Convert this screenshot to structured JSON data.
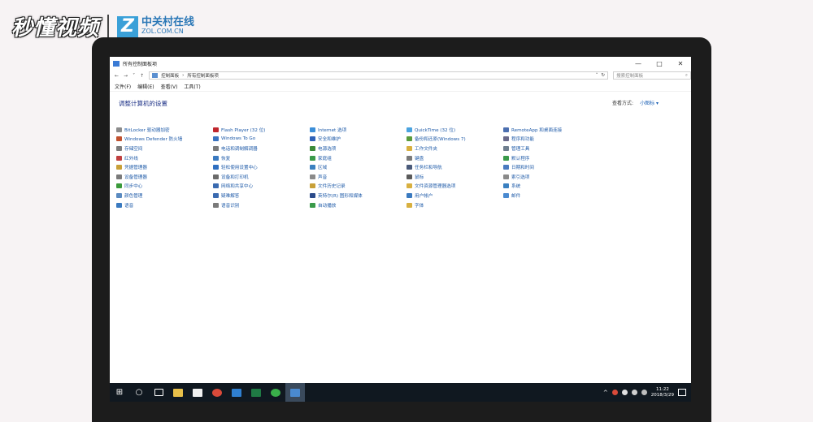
{
  "watermark": {
    "brand": "秒懂视频",
    "logo_letter": "Z",
    "cn": "中关村在线",
    "en": "ZOL.COM.CN"
  },
  "window": {
    "title": "所有控制面板项",
    "controls": [
      "—",
      "□",
      "✕"
    ]
  },
  "nav": {
    "back": "←",
    "forward": "→",
    "down": "˅",
    "up": "↑",
    "address_parts": [
      "控制面板",
      "›",
      "所有控制面板项"
    ],
    "address_dropdown": "˅",
    "refresh": "↻",
    "search_placeholder": "搜索控制面板",
    "search_icon": "⌕"
  },
  "menu": [
    "文件(F)",
    "编辑(E)",
    "查看(V)",
    "工具(T)"
  ],
  "heading": "调整计算机的设置",
  "view_by": {
    "label": "查看方式:",
    "value": "小图标 ▾"
  },
  "items": [
    {
      "label": "BitLocker 驱动器加密",
      "color": "#8c8c8c"
    },
    {
      "label": "Flash Player (32 位)",
      "color": "#c0262d"
    },
    {
      "label": "Internet 选项",
      "color": "#3b8ed8"
    },
    {
      "label": "QuickTime (32 位)",
      "color": "#4aa3df"
    },
    {
      "label": "RemoteApp 和桌面连接",
      "color": "#4c6fb0"
    },
    {
      "label": "Windows Defender 防火墙",
      "color": "#c0512f"
    },
    {
      "label": "Windows To Go",
      "color": "#3a73c0"
    },
    {
      "label": "安全和维护",
      "color": "#2f62b8"
    },
    {
      "label": "备份和还原(Windows 7)",
      "color": "#5a9b3c"
    },
    {
      "label": "程序和功能",
      "color": "#6a6a8a"
    },
    {
      "label": "存储空间",
      "color": "#7c7c7c"
    },
    {
      "label": "电话和调制解调器",
      "color": "#7a7a7a"
    },
    {
      "label": "电源选项",
      "color": "#3a8a3a"
    },
    {
      "label": "工作文件夹",
      "color": "#d8b040"
    },
    {
      "label": "管理工具",
      "color": "#6f7f8f"
    },
    {
      "label": "红外线",
      "color": "#c04040"
    },
    {
      "label": "恢复",
      "color": "#3a7ac0"
    },
    {
      "label": "家庭组",
      "color": "#3a9a4a"
    },
    {
      "label": "键盘",
      "color": "#7a7a7a"
    },
    {
      "label": "默认程序",
      "color": "#3a9a4a"
    },
    {
      "label": "凭据管理器",
      "color": "#c8a038"
    },
    {
      "label": "轻松使用设置中心",
      "color": "#2f6fc0"
    },
    {
      "label": "区域",
      "color": "#3a80c0"
    },
    {
      "label": "任务栏和导航",
      "color": "#4a5a7a"
    },
    {
      "label": "日期和时间",
      "color": "#4a7ac0"
    },
    {
      "label": "设备管理器",
      "color": "#7a7a7a"
    },
    {
      "label": "设备和打印机",
      "color": "#6a6a6a"
    },
    {
      "label": "声音",
      "color": "#8a8a8a"
    },
    {
      "label": "鼠标",
      "color": "#5a5a5a"
    },
    {
      "label": "索引选项",
      "color": "#8a8a8a"
    },
    {
      "label": "同步中心",
      "color": "#3a9a3a"
    },
    {
      "label": "网络和共享中心",
      "color": "#3a6ab0"
    },
    {
      "label": "文件历史记录",
      "color": "#c8a038"
    },
    {
      "label": "文件资源管理器选项",
      "color": "#d8b040"
    },
    {
      "label": "系统",
      "color": "#3a80c0"
    },
    {
      "label": "颜色管理",
      "color": "#5a8ac0"
    },
    {
      "label": "疑难解答",
      "color": "#3a6ab0"
    },
    {
      "label": "英特尔(R) 图形和媒体",
      "color": "#2a4a8a"
    },
    {
      "label": "用户帐户",
      "color": "#3a7ac0"
    },
    {
      "label": "邮件",
      "color": "#4a8ad0"
    },
    {
      "label": "语音",
      "color": "#3a7ac0"
    },
    {
      "label": "语音识别",
      "color": "#7a7a7a"
    },
    {
      "label": "自动播放",
      "color": "#3a9a4a"
    },
    {
      "label": "字体",
      "color": "#d8b040"
    }
  ],
  "taskbar": {
    "start_icon": "⊞",
    "search_icon": "○",
    "apps": [
      {
        "name": "task-view-icon",
        "color": "#101820"
      },
      {
        "name": "file-explorer-icon",
        "color": "#e8c04a"
      },
      {
        "name": "sticky-notes-icon",
        "color": "#f0f0f0"
      },
      {
        "name": "chrome-icon",
        "color": "#d94a3a"
      },
      {
        "name": "edge-icon",
        "color": "#2f7fd0"
      },
      {
        "name": "excel-icon",
        "color": "#1f7a44"
      },
      {
        "name": "wechat-icon",
        "color": "#3ab04a"
      },
      {
        "name": "control-panel-icon",
        "color": "#4a8ad0"
      }
    ],
    "tray_arrow": "^",
    "time": "11:22",
    "date": "2018/3/29"
  }
}
